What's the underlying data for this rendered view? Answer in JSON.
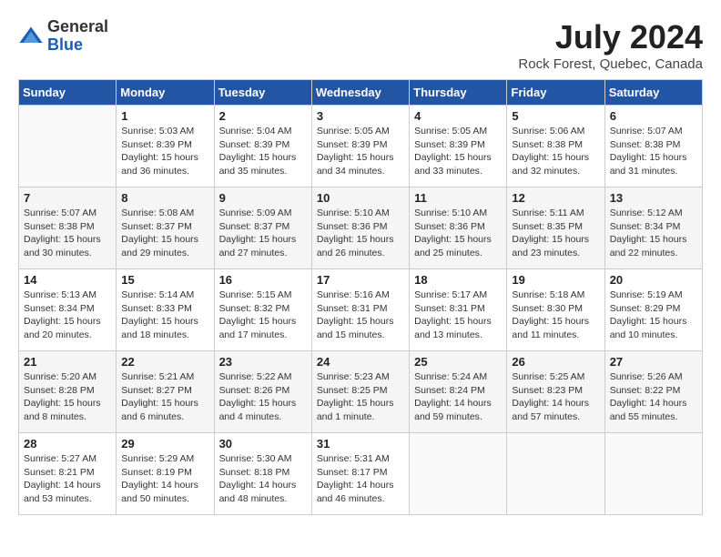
{
  "header": {
    "logo_line1": "General",
    "logo_line2": "Blue",
    "month_year": "July 2024",
    "location": "Rock Forest, Quebec, Canada"
  },
  "weekdays": [
    "Sunday",
    "Monday",
    "Tuesday",
    "Wednesday",
    "Thursday",
    "Friday",
    "Saturday"
  ],
  "weeks": [
    [
      {
        "day": "",
        "sunrise": "",
        "sunset": "",
        "daylight": ""
      },
      {
        "day": "1",
        "sunrise": "5:03 AM",
        "sunset": "8:39 PM",
        "daylight": "15 hours and 36 minutes."
      },
      {
        "day": "2",
        "sunrise": "5:04 AM",
        "sunset": "8:39 PM",
        "daylight": "15 hours and 35 minutes."
      },
      {
        "day": "3",
        "sunrise": "5:05 AM",
        "sunset": "8:39 PM",
        "daylight": "15 hours and 34 minutes."
      },
      {
        "day": "4",
        "sunrise": "5:05 AM",
        "sunset": "8:39 PM",
        "daylight": "15 hours and 33 minutes."
      },
      {
        "day": "5",
        "sunrise": "5:06 AM",
        "sunset": "8:38 PM",
        "daylight": "15 hours and 32 minutes."
      },
      {
        "day": "6",
        "sunrise": "5:07 AM",
        "sunset": "8:38 PM",
        "daylight": "15 hours and 31 minutes."
      }
    ],
    [
      {
        "day": "7",
        "sunrise": "5:07 AM",
        "sunset": "8:38 PM",
        "daylight": "15 hours and 30 minutes."
      },
      {
        "day": "8",
        "sunrise": "5:08 AM",
        "sunset": "8:37 PM",
        "daylight": "15 hours and 29 minutes."
      },
      {
        "day": "9",
        "sunrise": "5:09 AM",
        "sunset": "8:37 PM",
        "daylight": "15 hours and 27 minutes."
      },
      {
        "day": "10",
        "sunrise": "5:10 AM",
        "sunset": "8:36 PM",
        "daylight": "15 hours and 26 minutes."
      },
      {
        "day": "11",
        "sunrise": "5:10 AM",
        "sunset": "8:36 PM",
        "daylight": "15 hours and 25 minutes."
      },
      {
        "day": "12",
        "sunrise": "5:11 AM",
        "sunset": "8:35 PM",
        "daylight": "15 hours and 23 minutes."
      },
      {
        "day": "13",
        "sunrise": "5:12 AM",
        "sunset": "8:34 PM",
        "daylight": "15 hours and 22 minutes."
      }
    ],
    [
      {
        "day": "14",
        "sunrise": "5:13 AM",
        "sunset": "8:34 PM",
        "daylight": "15 hours and 20 minutes."
      },
      {
        "day": "15",
        "sunrise": "5:14 AM",
        "sunset": "8:33 PM",
        "daylight": "15 hours and 18 minutes."
      },
      {
        "day": "16",
        "sunrise": "5:15 AM",
        "sunset": "8:32 PM",
        "daylight": "15 hours and 17 minutes."
      },
      {
        "day": "17",
        "sunrise": "5:16 AM",
        "sunset": "8:31 PM",
        "daylight": "15 hours and 15 minutes."
      },
      {
        "day": "18",
        "sunrise": "5:17 AM",
        "sunset": "8:31 PM",
        "daylight": "15 hours and 13 minutes."
      },
      {
        "day": "19",
        "sunrise": "5:18 AM",
        "sunset": "8:30 PM",
        "daylight": "15 hours and 11 minutes."
      },
      {
        "day": "20",
        "sunrise": "5:19 AM",
        "sunset": "8:29 PM",
        "daylight": "15 hours and 10 minutes."
      }
    ],
    [
      {
        "day": "21",
        "sunrise": "5:20 AM",
        "sunset": "8:28 PM",
        "daylight": "15 hours and 8 minutes."
      },
      {
        "day": "22",
        "sunrise": "5:21 AM",
        "sunset": "8:27 PM",
        "daylight": "15 hours and 6 minutes."
      },
      {
        "day": "23",
        "sunrise": "5:22 AM",
        "sunset": "8:26 PM",
        "daylight": "15 hours and 4 minutes."
      },
      {
        "day": "24",
        "sunrise": "5:23 AM",
        "sunset": "8:25 PM",
        "daylight": "15 hours and 1 minute."
      },
      {
        "day": "25",
        "sunrise": "5:24 AM",
        "sunset": "8:24 PM",
        "daylight": "14 hours and 59 minutes."
      },
      {
        "day": "26",
        "sunrise": "5:25 AM",
        "sunset": "8:23 PM",
        "daylight": "14 hours and 57 minutes."
      },
      {
        "day": "27",
        "sunrise": "5:26 AM",
        "sunset": "8:22 PM",
        "daylight": "14 hours and 55 minutes."
      }
    ],
    [
      {
        "day": "28",
        "sunrise": "5:27 AM",
        "sunset": "8:21 PM",
        "daylight": "14 hours and 53 minutes."
      },
      {
        "day": "29",
        "sunrise": "5:29 AM",
        "sunset": "8:19 PM",
        "daylight": "14 hours and 50 minutes."
      },
      {
        "day": "30",
        "sunrise": "5:30 AM",
        "sunset": "8:18 PM",
        "daylight": "14 hours and 48 minutes."
      },
      {
        "day": "31",
        "sunrise": "5:31 AM",
        "sunset": "8:17 PM",
        "daylight": "14 hours and 46 minutes."
      },
      {
        "day": "",
        "sunrise": "",
        "sunset": "",
        "daylight": ""
      },
      {
        "day": "",
        "sunrise": "",
        "sunset": "",
        "daylight": ""
      },
      {
        "day": "",
        "sunrise": "",
        "sunset": "",
        "daylight": ""
      }
    ]
  ]
}
